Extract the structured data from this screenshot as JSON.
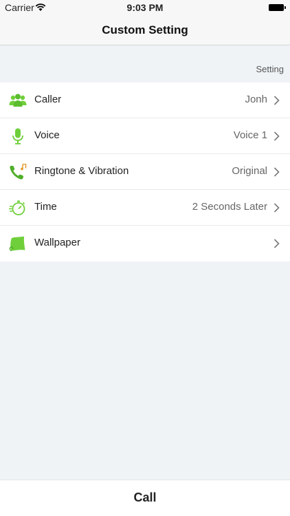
{
  "status_bar": {
    "carrier": "Carrier",
    "time": "9:03 PM"
  },
  "nav": {
    "title": "Custom Setting"
  },
  "section": {
    "header": "Setting"
  },
  "rows": [
    {
      "label": "Caller",
      "value": "Jonh",
      "icon": "people-icon"
    },
    {
      "label": "Voice",
      "value": "Voice 1",
      "icon": "microphone-icon"
    },
    {
      "label": "Ringtone & Vibration",
      "value": "Original",
      "icon": "phone-music-icon"
    },
    {
      "label": "Time",
      "value": "2 Seconds Later",
      "icon": "stopwatch-icon"
    },
    {
      "label": "Wallpaper",
      "value": "",
      "icon": "wallpaper-icon"
    }
  ],
  "call_button": {
    "label": "Call"
  },
  "colors": {
    "accent": "#6fcf3b",
    "accent_dark": "#4fae2a",
    "background": "#eff3f6"
  }
}
